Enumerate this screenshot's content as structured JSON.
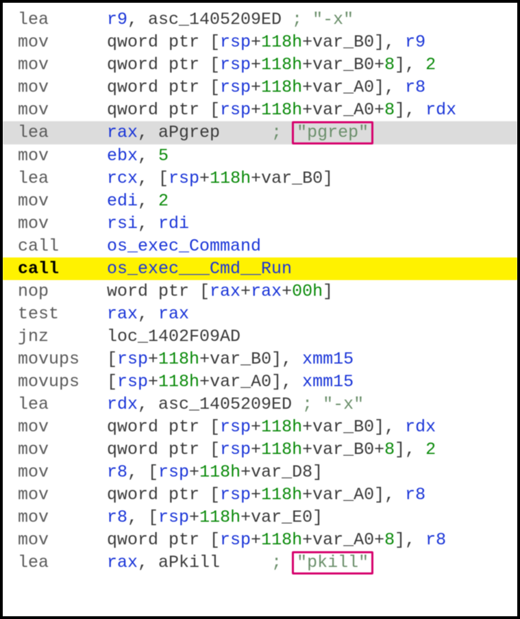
{
  "asm": {
    "lines": [
      {
        "mn": "lea",
        "ops": [
          [
            "reg",
            "r9"
          ],
          [
            "txt",
            ", "
          ],
          [
            "op",
            "asc_1405209ED"
          ]
        ],
        "comment": "\"-x\"",
        "boxed": false
      },
      {
        "mn": "mov",
        "ops": [
          [
            "txt",
            "qword ptr ["
          ],
          [
            "reg",
            "rsp"
          ],
          [
            "txt",
            "+"
          ],
          [
            "hex",
            "118h"
          ],
          [
            "txt",
            "+"
          ],
          [
            "op",
            "var_B0"
          ],
          [
            "txt",
            "], "
          ],
          [
            "reg",
            "r9"
          ]
        ]
      },
      {
        "mn": "mov",
        "ops": [
          [
            "txt",
            "qword ptr ["
          ],
          [
            "reg",
            "rsp"
          ],
          [
            "txt",
            "+"
          ],
          [
            "hex",
            "118h"
          ],
          [
            "txt",
            "+"
          ],
          [
            "op",
            "var_B0"
          ],
          [
            "txt",
            "+"
          ],
          [
            "num",
            "8"
          ],
          [
            "txt",
            "], "
          ],
          [
            "num",
            "2"
          ]
        ]
      },
      {
        "mn": "mov",
        "ops": [
          [
            "txt",
            "qword ptr ["
          ],
          [
            "reg",
            "rsp"
          ],
          [
            "txt",
            "+"
          ],
          [
            "hex",
            "118h"
          ],
          [
            "txt",
            "+"
          ],
          [
            "op",
            "var_A0"
          ],
          [
            "txt",
            "], "
          ],
          [
            "reg",
            "r8"
          ]
        ]
      },
      {
        "mn": "mov",
        "ops": [
          [
            "txt",
            "qword ptr ["
          ],
          [
            "reg",
            "rsp"
          ],
          [
            "txt",
            "+"
          ],
          [
            "hex",
            "118h"
          ],
          [
            "txt",
            "+"
          ],
          [
            "op",
            "var_A0"
          ],
          [
            "txt",
            "+"
          ],
          [
            "num",
            "8"
          ],
          [
            "txt",
            "], "
          ],
          [
            "reg",
            "rdx"
          ]
        ]
      },
      {
        "mn": "lea",
        "hl": "grey",
        "pad": true,
        "ops": [
          [
            "reg",
            "rax"
          ],
          [
            "txt",
            ", "
          ],
          [
            "op",
            "aPgrep"
          ]
        ],
        "comment": "\"pgrep\"",
        "boxed": true
      },
      {
        "mn": "mov",
        "ops": [
          [
            "reg",
            "ebx"
          ],
          [
            "txt",
            ", "
          ],
          [
            "num",
            "5"
          ]
        ]
      },
      {
        "mn": "lea",
        "ops": [
          [
            "reg",
            "rcx"
          ],
          [
            "txt",
            ", ["
          ],
          [
            "reg",
            "rsp"
          ],
          [
            "txt",
            "+"
          ],
          [
            "hex",
            "118h"
          ],
          [
            "txt",
            "+"
          ],
          [
            "op",
            "var_B0"
          ],
          [
            "txt",
            "]"
          ]
        ]
      },
      {
        "mn": "mov",
        "ops": [
          [
            "reg",
            "edi"
          ],
          [
            "txt",
            ", "
          ],
          [
            "num",
            "2"
          ]
        ]
      },
      {
        "mn": "mov",
        "ops": [
          [
            "reg",
            "rsi"
          ],
          [
            "txt",
            ", "
          ],
          [
            "reg",
            "rdi"
          ]
        ]
      },
      {
        "mn": "call",
        "ops": [
          [
            "func",
            "os_exec_Command"
          ]
        ]
      },
      {
        "mn": "call",
        "hl": "yellow",
        "ops": [
          [
            "func",
            "os_exec___Cmd__Run"
          ]
        ]
      },
      {
        "mn": "nop",
        "ops": [
          [
            "txt",
            "word ptr ["
          ],
          [
            "reg",
            "rax"
          ],
          [
            "txt",
            "+"
          ],
          [
            "reg",
            "rax"
          ],
          [
            "txt",
            "+"
          ],
          [
            "hex",
            "00h"
          ],
          [
            "txt",
            "]"
          ]
        ]
      },
      {
        "mn": "test",
        "ops": [
          [
            "reg",
            "rax"
          ],
          [
            "txt",
            ", "
          ],
          [
            "reg",
            "rax"
          ]
        ]
      },
      {
        "mn": "jnz",
        "ops": [
          [
            "op",
            "loc_1402F09AD"
          ]
        ]
      },
      {
        "mn": "movups",
        "ops": [
          [
            "txt",
            "["
          ],
          [
            "reg",
            "rsp"
          ],
          [
            "txt",
            "+"
          ],
          [
            "hex",
            "118h"
          ],
          [
            "txt",
            "+"
          ],
          [
            "op",
            "var_B0"
          ],
          [
            "txt",
            "], "
          ],
          [
            "reg",
            "xmm15"
          ]
        ]
      },
      {
        "mn": "movups",
        "ops": [
          [
            "txt",
            "["
          ],
          [
            "reg",
            "rsp"
          ],
          [
            "txt",
            "+"
          ],
          [
            "hex",
            "118h"
          ],
          [
            "txt",
            "+"
          ],
          [
            "op",
            "var_A0"
          ],
          [
            "txt",
            "], "
          ],
          [
            "reg",
            "xmm15"
          ]
        ]
      },
      {
        "mn": "lea",
        "ops": [
          [
            "reg",
            "rdx"
          ],
          [
            "txt",
            ", "
          ],
          [
            "op",
            "asc_1405209ED"
          ]
        ],
        "comment": "\"-x\"",
        "boxed": false
      },
      {
        "mn": "mov",
        "ops": [
          [
            "txt",
            "qword ptr ["
          ],
          [
            "reg",
            "rsp"
          ],
          [
            "txt",
            "+"
          ],
          [
            "hex",
            "118h"
          ],
          [
            "txt",
            "+"
          ],
          [
            "op",
            "var_B0"
          ],
          [
            "txt",
            "], "
          ],
          [
            "reg",
            "rdx"
          ]
        ]
      },
      {
        "mn": "mov",
        "ops": [
          [
            "txt",
            "qword ptr ["
          ],
          [
            "reg",
            "rsp"
          ],
          [
            "txt",
            "+"
          ],
          [
            "hex",
            "118h"
          ],
          [
            "txt",
            "+"
          ],
          [
            "op",
            "var_B0"
          ],
          [
            "txt",
            "+"
          ],
          [
            "num",
            "8"
          ],
          [
            "txt",
            "], "
          ],
          [
            "num",
            "2"
          ]
        ]
      },
      {
        "mn": "mov",
        "ops": [
          [
            "reg",
            "r8"
          ],
          [
            "txt",
            ", ["
          ],
          [
            "reg",
            "rsp"
          ],
          [
            "txt",
            "+"
          ],
          [
            "hex",
            "118h"
          ],
          [
            "txt",
            "+"
          ],
          [
            "op",
            "var_D8"
          ],
          [
            "txt",
            "]"
          ]
        ]
      },
      {
        "mn": "mov",
        "ops": [
          [
            "txt",
            "qword ptr ["
          ],
          [
            "reg",
            "rsp"
          ],
          [
            "txt",
            "+"
          ],
          [
            "hex",
            "118h"
          ],
          [
            "txt",
            "+"
          ],
          [
            "op",
            "var_A0"
          ],
          [
            "txt",
            "], "
          ],
          [
            "reg",
            "r8"
          ]
        ]
      },
      {
        "mn": "mov",
        "ops": [
          [
            "reg",
            "r8"
          ],
          [
            "txt",
            ", ["
          ],
          [
            "reg",
            "rsp"
          ],
          [
            "txt",
            "+"
          ],
          [
            "hex",
            "118h"
          ],
          [
            "txt",
            "+"
          ],
          [
            "op",
            "var_E0"
          ],
          [
            "txt",
            "]"
          ]
        ]
      },
      {
        "mn": "mov",
        "ops": [
          [
            "txt",
            "qword ptr ["
          ],
          [
            "reg",
            "rsp"
          ],
          [
            "txt",
            "+"
          ],
          [
            "hex",
            "118h"
          ],
          [
            "txt",
            "+"
          ],
          [
            "op",
            "var_A0"
          ],
          [
            "txt",
            "+"
          ],
          [
            "num",
            "8"
          ],
          [
            "txt",
            "], "
          ],
          [
            "reg",
            "r8"
          ]
        ]
      },
      {
        "mn": "lea",
        "pad": true,
        "ops": [
          [
            "reg",
            "rax"
          ],
          [
            "txt",
            ", "
          ],
          [
            "op",
            "aPkill"
          ]
        ],
        "comment": "\"pkill\"",
        "boxed": true
      }
    ]
  }
}
